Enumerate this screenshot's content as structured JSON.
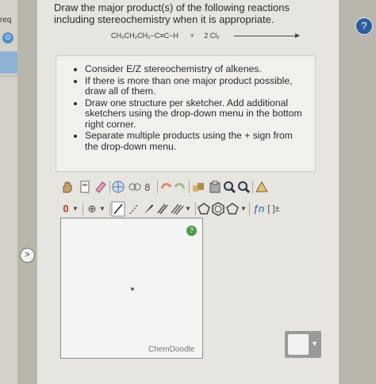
{
  "sidebar": {
    "req_label": "req"
  },
  "question": {
    "text": "Draw the major product(s) of the following reactions including stereochemistry when it is appropriate.",
    "reactant": "CH₃CH₂CH₂−C≡C−H",
    "plus": "+",
    "reagent": "2 Cl₂"
  },
  "instructions": [
    "Consider E/Z stereochemistry of alkenes.",
    "If there is more than one major product possible, draw all of them.",
    "Draw one structure per sketcher. Add additional sketchers using the drop-down menu in the bottom right corner.",
    "Separate multiple products using the + sign from the drop-down menu."
  ],
  "toolbar": {
    "row1": [
      "hand-icon",
      "lasso-icon",
      "eraser-icon",
      "center-icon",
      "rotate-icon",
      "undo-icon",
      "redo-icon",
      "template-icon",
      "clipboard-icon",
      "zoom-in-icon",
      "zoom-out-icon",
      "clean-icon"
    ],
    "charge_label": "0",
    "atom_label": "⊕",
    "fn_label": "ƒn",
    "bracket_label": "[ ]±"
  },
  "sketcher": {
    "brand": "ChemDoodle",
    "badge": "?"
  },
  "colors": {
    "help_blue": "#2c5f9b",
    "badge_green": "#4e9a4a",
    "accent_blue": "#4f8fc7"
  }
}
